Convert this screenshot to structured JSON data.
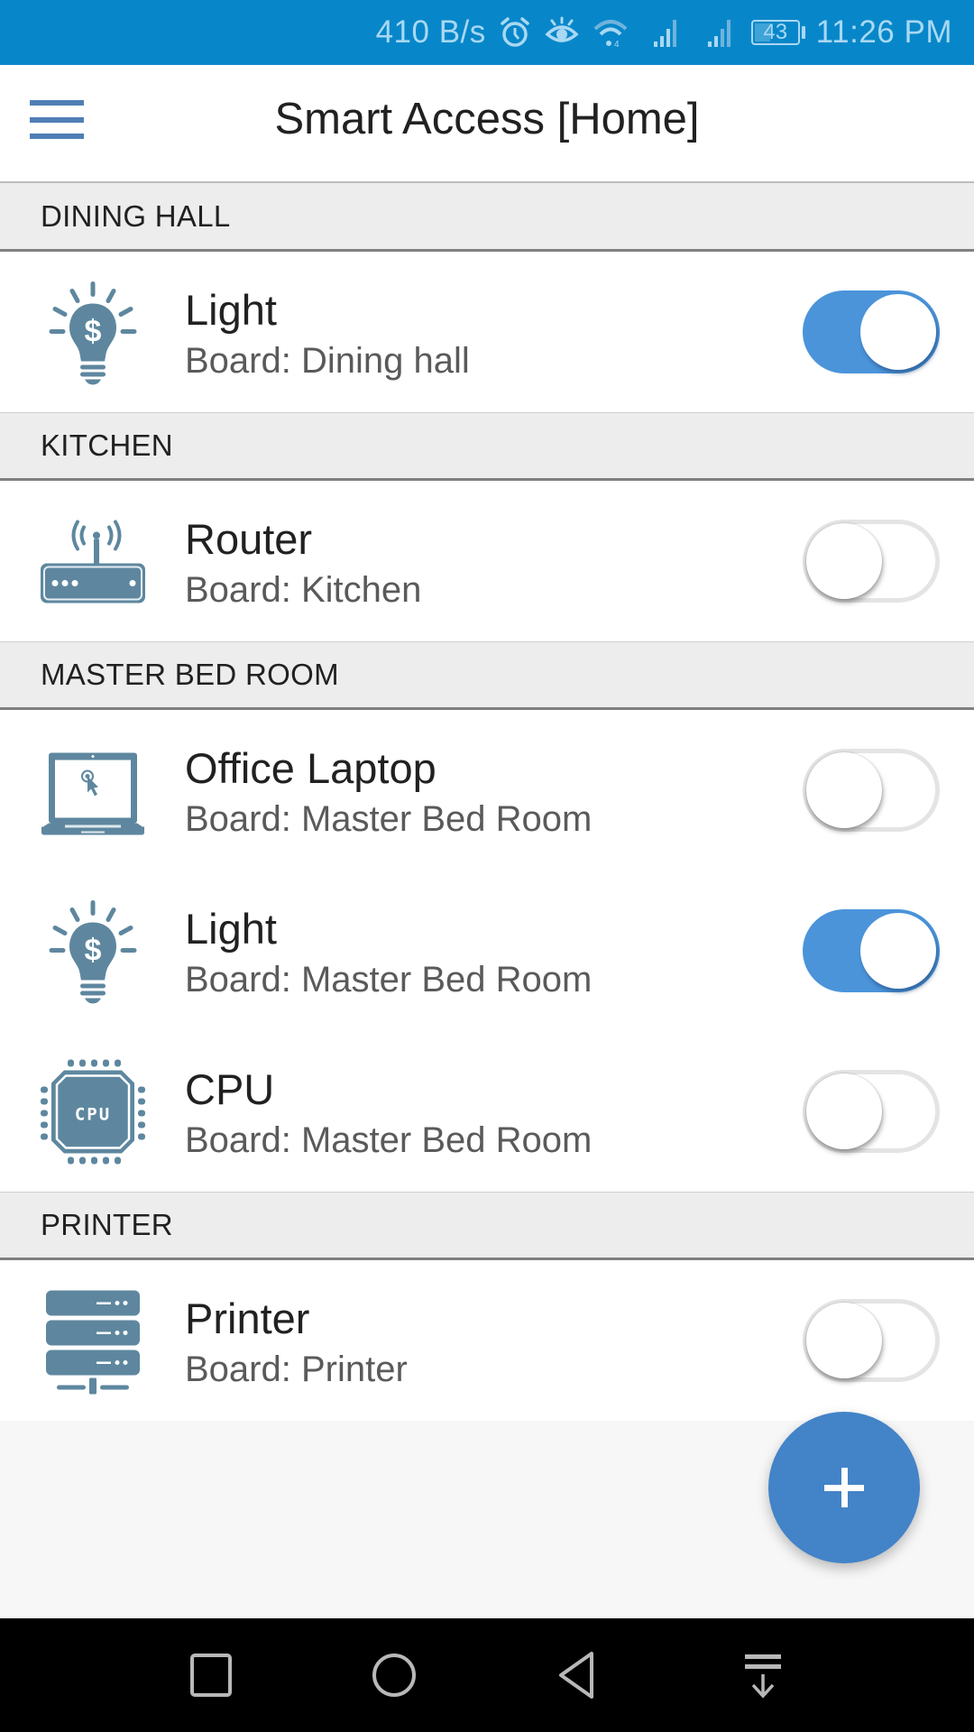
{
  "status_bar": {
    "net_speed": "410 B/s",
    "icons": [
      "alarm-icon",
      "eye-comfort-icon",
      "wifi-icon",
      "signal-icon-sim1",
      "signal-icon-sim2"
    ],
    "battery_level": "43",
    "battery_percent": 43,
    "time": "11:26 PM"
  },
  "app_bar": {
    "title": "Smart Access [Home]",
    "menu_icon": "hamburger-menu-icon"
  },
  "sections": [
    {
      "header": "DINING HALL",
      "devices": [
        {
          "name": "Light",
          "board": "Board: Dining hall",
          "icon": "lightbulb-dollar-icon",
          "on": true
        }
      ]
    },
    {
      "header": "KITCHEN",
      "devices": [
        {
          "name": "Router",
          "board": "Board: Kitchen",
          "icon": "router-icon",
          "on": false
        }
      ]
    },
    {
      "header": "MASTER BED ROOM",
      "devices": [
        {
          "name": "Office Laptop",
          "board": "Board: Master Bed Room",
          "icon": "laptop-icon",
          "on": false
        },
        {
          "name": "Light",
          "board": "Board: Master Bed Room",
          "icon": "lightbulb-dollar-icon",
          "on": true
        },
        {
          "name": "CPU",
          "board": "Board: Master Bed Room",
          "icon": "cpu-chip-icon",
          "on": false
        }
      ]
    },
    {
      "header": "PRINTER",
      "devices": [
        {
          "name": "Printer",
          "board": "Board: Printer",
          "icon": "server-stack-icon",
          "on": false
        }
      ]
    }
  ],
  "fab": {
    "label": "+",
    "icon": "plus-icon"
  },
  "nav_bar": {
    "buttons": [
      "recents-square-icon",
      "home-circle-icon",
      "back-triangle-icon",
      "notification-pull-down-icon"
    ]
  },
  "colors": {
    "status_bar": "#0787c9",
    "accent": "#4b94da",
    "fab": "#4383c8",
    "icon": "#5e879f",
    "menu_icon": "#4f7fb5",
    "section_bg": "#ededed"
  }
}
